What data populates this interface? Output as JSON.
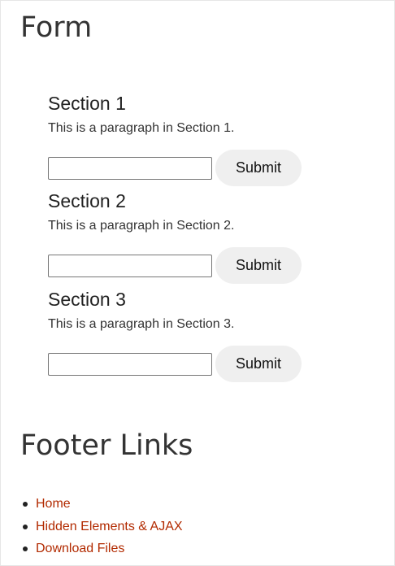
{
  "form": {
    "title": "Form",
    "sections": [
      {
        "heading": "Section 1",
        "text": "This is a paragraph in Section 1.",
        "input_value": "",
        "button_label": "Submit"
      },
      {
        "heading": "Section 2",
        "text": "This is a paragraph in Section 2.",
        "input_value": "",
        "button_label": "Submit"
      },
      {
        "heading": "Section 3",
        "text": "This is a paragraph in Section 3.",
        "input_value": "",
        "button_label": "Submit"
      }
    ]
  },
  "footer": {
    "title": "Footer Links",
    "links": [
      {
        "label": "Home"
      },
      {
        "label": "Hidden Elements & AJAX"
      },
      {
        "label": "Download Files"
      }
    ]
  },
  "colors": {
    "link": "#b22a00",
    "button_bg": "#efefef",
    "heading": "#333333"
  }
}
